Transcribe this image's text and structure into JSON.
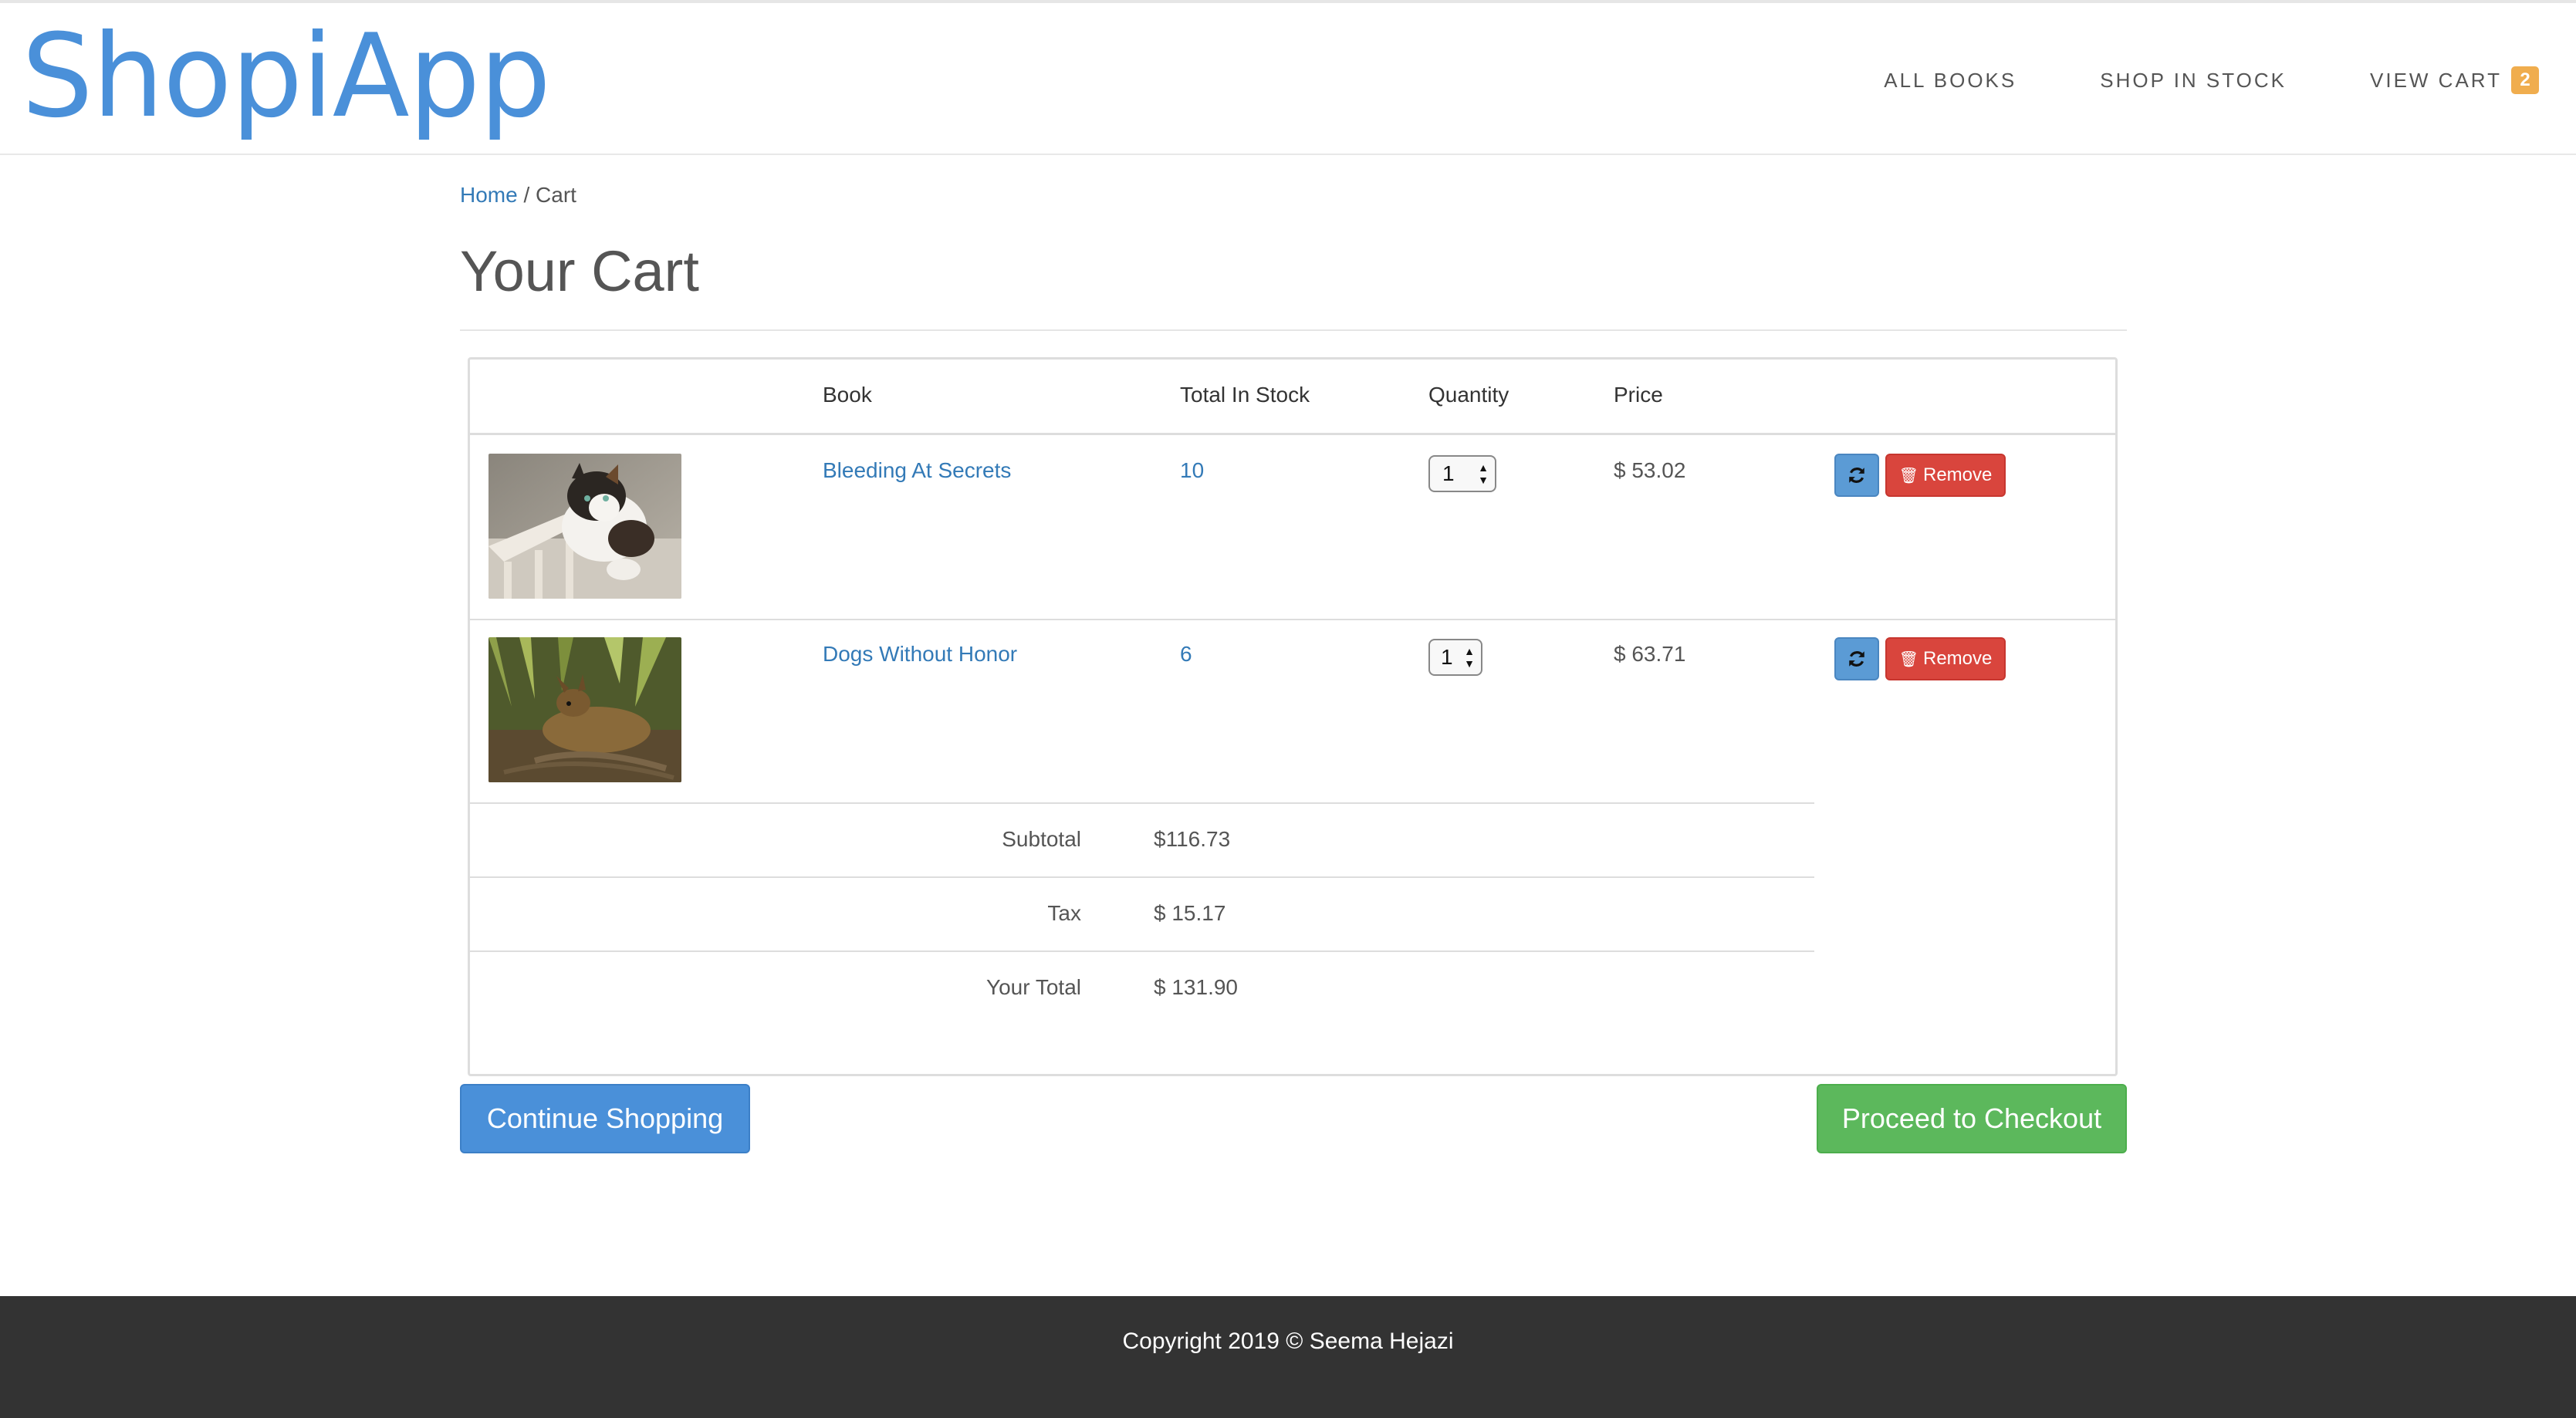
{
  "header": {
    "brand": "ShopiApp",
    "nav": [
      {
        "label": "ALL BOOKS"
      },
      {
        "label": "SHOP IN STOCK"
      },
      {
        "label": "VIEW CART"
      }
    ],
    "cart_count": "2"
  },
  "breadcrumb": {
    "home": "Home",
    "separator": " / ",
    "current": "Cart"
  },
  "page_title": "Your Cart",
  "table": {
    "headers": [
      "",
      "Book",
      "Total In Stock",
      "Quantity",
      "Price"
    ],
    "rows": [
      {
        "image": "calico-cat-photo",
        "book": "Bleeding At Secrets",
        "stock": "10",
        "quantity": "1",
        "price": "$ 53.02",
        "remove_label": "Remove"
      },
      {
        "image": "deer-in-brush-photo",
        "book": "Dogs Without Honor",
        "stock": "6",
        "quantity": "1",
        "price": "$ 63.71",
        "remove_label": "Remove"
      }
    ],
    "summary": [
      {
        "label": "Subtotal",
        "value": "$116.73"
      },
      {
        "label": "Tax",
        "value": "$ 15.17"
      },
      {
        "label": "Your Total",
        "value": "$ 131.90"
      }
    ]
  },
  "actions": {
    "continue_label": "Continue Shopping",
    "checkout_label": "Proceed to Checkout"
  },
  "footer": {
    "copyright": "Copyright 2019 © Seema Hejazi"
  },
  "colors": {
    "brand": "#4a90d9",
    "link": "#337ab7",
    "danger": "#d9453d",
    "success": "#5cb85c",
    "badge": "#f0ad4e",
    "footer": "#333333"
  }
}
